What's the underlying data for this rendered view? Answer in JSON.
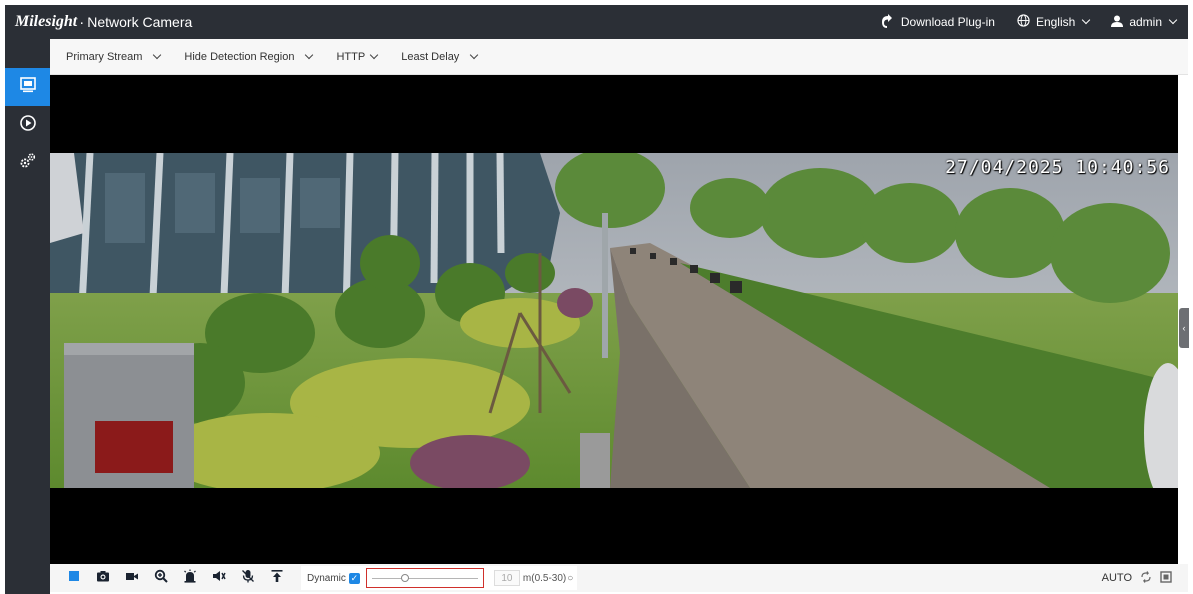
{
  "header": {
    "brand_logo": "Milesight",
    "brand_sep": "·",
    "brand_product": "Network Camera",
    "download_label": "Download Plug-in",
    "language_label": "English",
    "user_label": "admin"
  },
  "sidebar": {
    "items": [
      {
        "name": "live-view",
        "icon": "monitor-icon",
        "active": true
      },
      {
        "name": "playback",
        "icon": "play-circle-icon",
        "active": false
      },
      {
        "name": "settings",
        "icon": "gears-icon",
        "active": false
      }
    ]
  },
  "toolbar": {
    "stream_label": "Primary Stream",
    "detection_label": "Hide Detection Region",
    "protocol_label": "HTTP",
    "delay_label": "Least Delay"
  },
  "video": {
    "osd_timestamp": "27/04/2025 10:40:56"
  },
  "controls": {
    "icons": [
      "stop-icon",
      "snapshot-icon",
      "record-icon",
      "zoom-in-icon",
      "alarm-icon",
      "audio-mute-icon",
      "microphone-icon",
      "upload-icon"
    ],
    "dynamic_label": "Dynamic",
    "dynamic_checked": true,
    "slider_level": 0.3,
    "value": "10",
    "range_label": "m(0.5-30)",
    "auto_label": "AUTO"
  },
  "colors": {
    "header_bg": "#2b2f36",
    "accent": "#1e88e5",
    "highlight_border": "#d0302b",
    "privacy_mask": "#8b1a1a"
  }
}
